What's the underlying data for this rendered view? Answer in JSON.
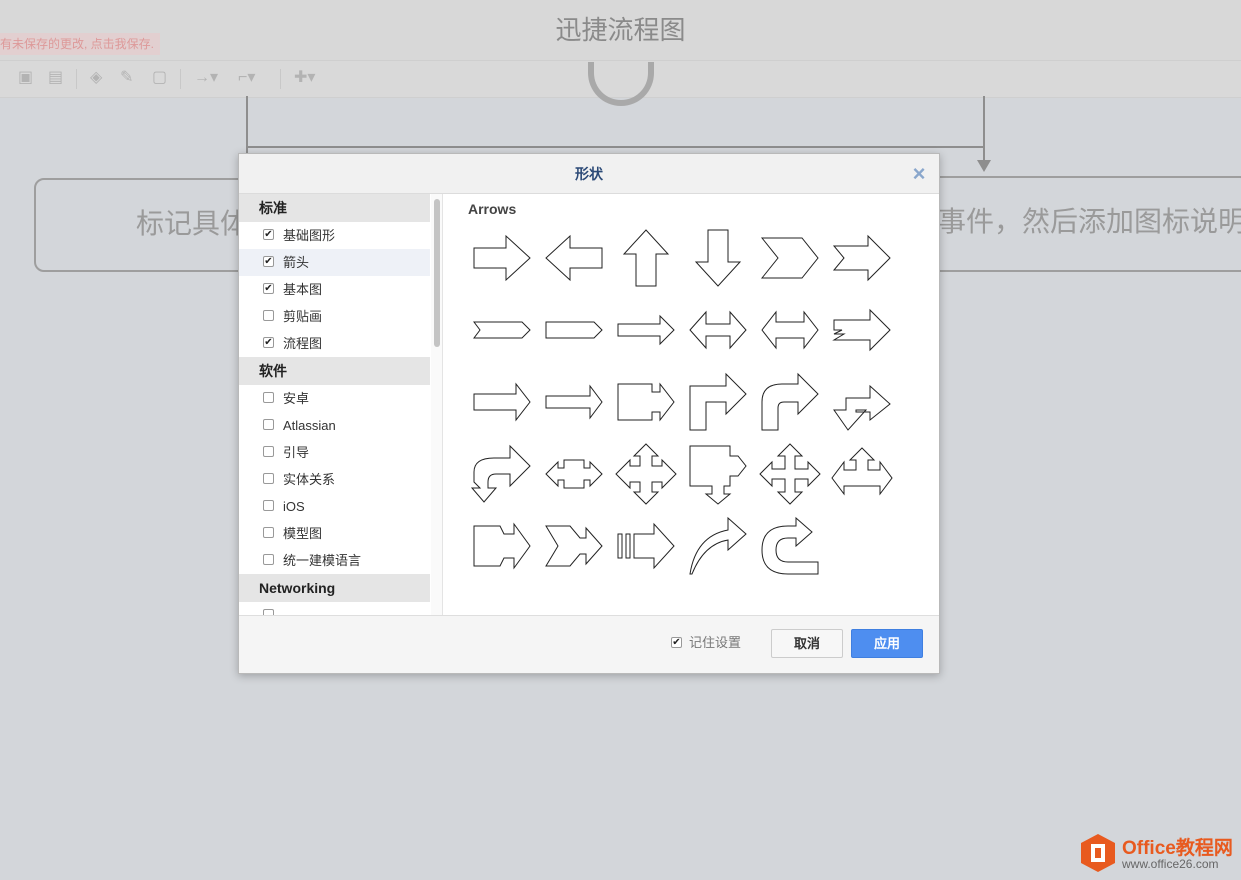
{
  "app": {
    "title": "迅捷流程图",
    "unsaved_notice": "有未保存的更改, 点击我保存.",
    "canvas_text_left": "标记具体",
    "canvas_text_right": "事件，然后添加图标说明"
  },
  "dialog": {
    "title": "形状",
    "close_glyph": "×",
    "content_title": "Arrows",
    "categories": [
      {
        "header": "标准",
        "items": [
          {
            "label": "基础图形",
            "checked": true
          },
          {
            "label": "箭头",
            "checked": true,
            "highlighted": true
          },
          {
            "label": "基本图",
            "checked": true
          },
          {
            "label": "剪贴画",
            "checked": false
          },
          {
            "label": "流程图",
            "checked": true
          }
        ]
      },
      {
        "header": "软件",
        "items": [
          {
            "label": "安卓",
            "checked": false
          },
          {
            "label": "Atlassian",
            "checked": false
          },
          {
            "label": "引导",
            "checked": false
          },
          {
            "label": "实体关系",
            "checked": false
          },
          {
            "label": "iOS",
            "checked": false
          },
          {
            "label": "模型图",
            "checked": false
          },
          {
            "label": "统一建模语言",
            "checked": false
          }
        ]
      },
      {
        "header": "Networking",
        "items": [
          {
            "label": "",
            "checked": false
          }
        ]
      }
    ],
    "shapes": [
      "arrow-right-icon",
      "arrow-left-icon",
      "arrow-up-icon",
      "arrow-down-icon",
      "chevron-icon",
      "notched-arrow-icon",
      "tag-right-icon",
      "pentagon-right-icon",
      "slim-arrow-right-icon",
      "double-arrow-icon",
      "double-arrow-wide-icon",
      "striped-arrow-icon",
      "outline-arrow-right-icon",
      "outline-arrow-right-slim-icon",
      "block-arrow-right-icon",
      "bent-arrow-icon",
      "curved-bent-arrow-icon",
      "bent-down-arrow-icon",
      "u-turn-arrow-icon",
      "left-right-callout-icon",
      "quad-arrow-icon",
      "corner-arrow-icon",
      "cross-arrow-icon",
      "tri-arrow-icon",
      "notched-block-arrow-icon",
      "split-arrow-icon",
      "striped-block-arrow-icon",
      "curved-arrow-icon",
      "hook-arrow-icon"
    ],
    "remember_label": "记住设置",
    "remember_checked": true,
    "cancel_label": "取消",
    "apply_label": "应用"
  },
  "watermark": {
    "title": "Office教程网",
    "url": "www.office26.com"
  },
  "colors": {
    "accent": "#4e8ef0",
    "dialog_title": "#2c4a77",
    "watermark": "#e85a1f"
  }
}
